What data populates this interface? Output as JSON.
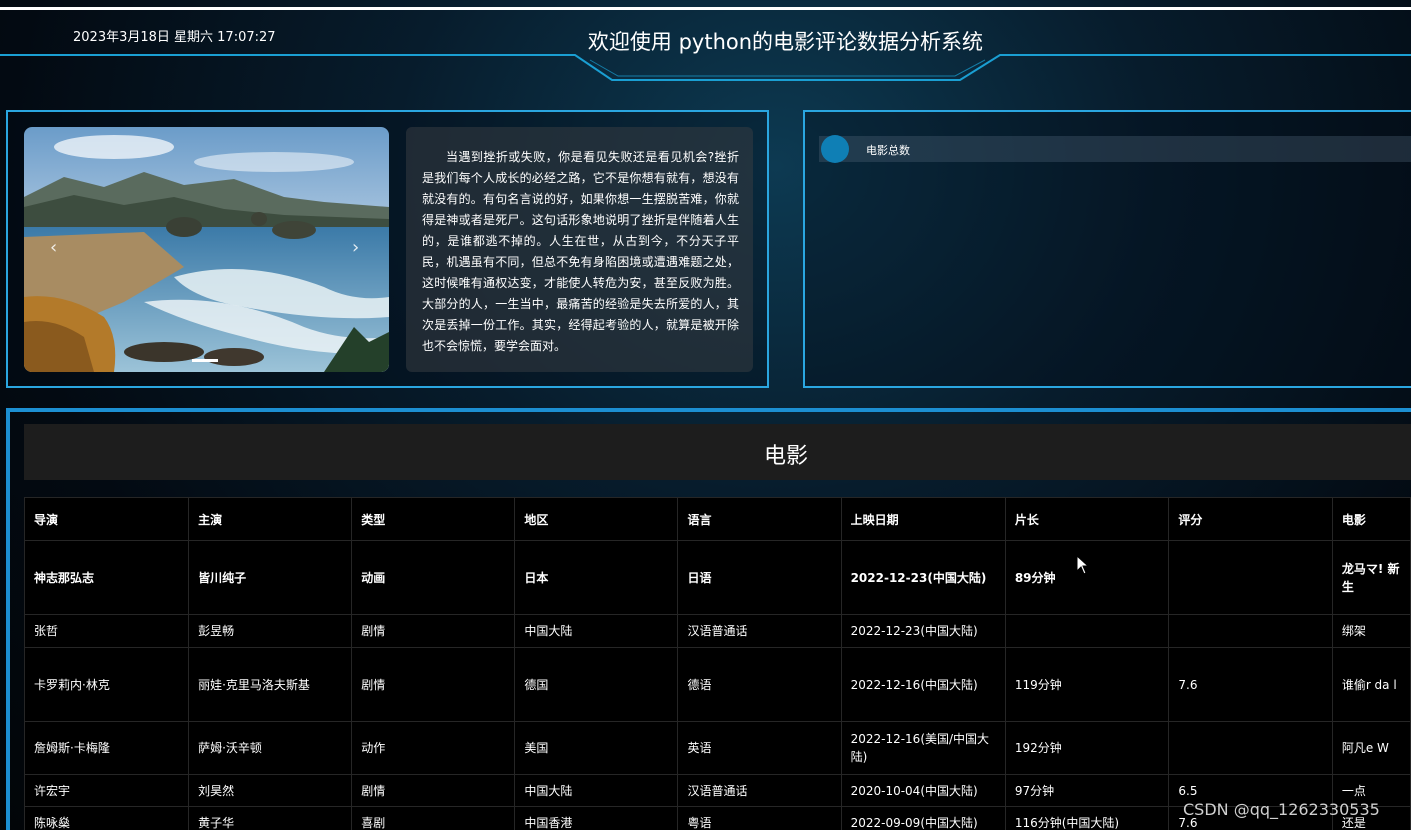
{
  "header": {
    "datetime": "2023年3月18日 星期六 17:07:27",
    "title": "欢迎使用 python的电影评论数据分析系统"
  },
  "carousel": {
    "prev_icon": "chevron-left-icon",
    "next_icon": "chevron-right-icon",
    "prev_glyph": "‹",
    "next_glyph": "›",
    "image_semantic": "coastal-landscape-image"
  },
  "quote": {
    "text": "当遇到挫折或失败，你是看见失败还是看见机会?挫折是我们每个人成长的必经之路，它不是你想有就有，想没有就没有的。有句名言说的好，如果你想一生摆脱苦难，你就得是神或者是死尸。这句话形象地说明了挫折是伴随着人生的，是谁都逃不掉的。人生在世，从古到今，不分天子平民，机遇虽有不同，但总不免有身陷困境或遭遇难题之处，这时候唯有通权达变，才能使人转危为安，甚至反败为胜。大部分的人，一生当中，最痛苦的经验是失去所爱的人，其次是丢掉一份工作。其实，经得起考验的人，就算是被开除也不会惊慌，要学会面对。"
  },
  "stats": {
    "label": "电影总数"
  },
  "movies": {
    "title": "电影",
    "columns": [
      "导演",
      "主演",
      "类型",
      "地区",
      "语言",
      "上映日期",
      "片长",
      "评分",
      "电影"
    ],
    "rows": [
      [
        "神志那弘志",
        "皆川纯子",
        "动画",
        "日本",
        "日语",
        "2022-12-23(中国大陆)",
        "89分钟",
        "",
        "龙马マ! 新生"
      ],
      [
        "张哲",
        "彭昱畅",
        "剧情",
        "中国大陆",
        "汉语普通话",
        "2022-12-23(中国大陆)",
        "",
        "",
        "绑架"
      ],
      [
        "卡罗莉内·林克",
        "丽娃·克里马洛夫斯基",
        "剧情",
        "德国",
        "德语",
        "2022-12-16(中国大陆)",
        "119分钟",
        "7.6",
        "谁偷r da l"
      ],
      [
        "詹姆斯·卡梅隆",
        "萨姆·沃辛顿",
        "动作",
        "美国",
        "英语",
        "2022-12-16(美国/中国大陆)",
        "192分钟",
        "",
        "阿凡e W"
      ],
      [
        "许宏宇",
        "刘昊然",
        "剧情",
        "中国大陆",
        "汉语普通话",
        "2020-10-04(中国大陆)",
        "97分钟",
        "6.5",
        "一点"
      ],
      [
        "陈咏燊",
        "黄子华",
        "喜剧",
        "中国香港",
        "粤语",
        "2022-09-09(中国大陆)",
        "116分钟(中国大陆)",
        "7.6",
        "还是"
      ]
    ]
  },
  "watermark": "CSDN @qq_1262330535",
  "colors": {
    "frame_accent": "#2aa6e0",
    "stat_dot": "#0f7fb5"
  }
}
